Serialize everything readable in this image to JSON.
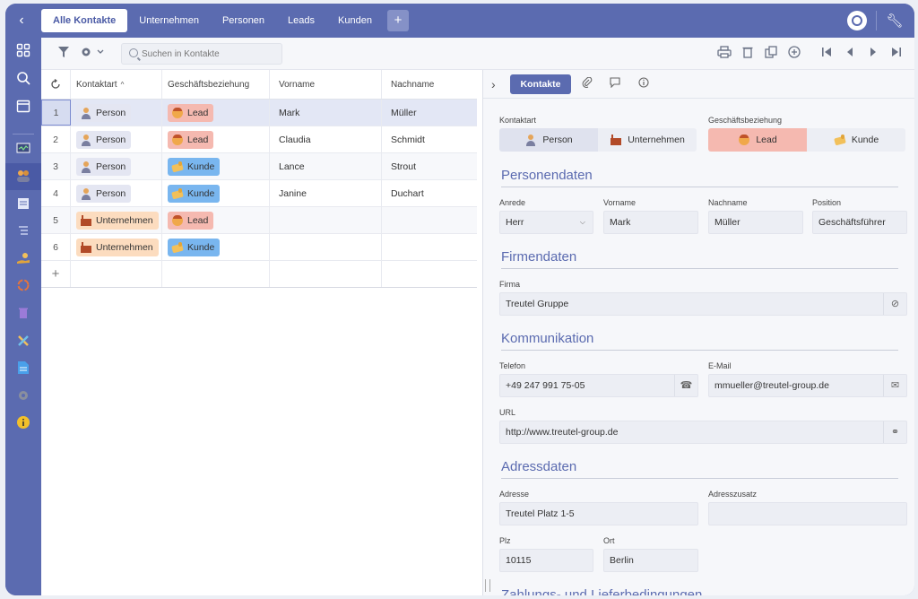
{
  "nav": {
    "back": "‹",
    "tabs": [
      {
        "label": "Alle Kontakte",
        "active": true
      },
      {
        "label": "Unternehmen"
      },
      {
        "label": "Personen"
      },
      {
        "label": "Leads"
      },
      {
        "label": "Kunden"
      }
    ],
    "add_tab": "+"
  },
  "toolbar": {
    "search_placeholder": "Suchen in Kontakte"
  },
  "grid": {
    "columns": [
      "Kontaktart",
      "Geschäftsbeziehung",
      "Vorname",
      "Nachname"
    ],
    "sort_indicator": "^",
    "rows": [
      {
        "num": "1",
        "kontaktart": "Person",
        "beziehung": "Lead",
        "vorname": "Mark",
        "nachname": "Müller"
      },
      {
        "num": "2",
        "kontaktart": "Person",
        "beziehung": "Lead",
        "vorname": "Claudia",
        "nachname": "Schmidt"
      },
      {
        "num": "3",
        "kontaktart": "Person",
        "beziehung": "Kunde",
        "vorname": "Lance",
        "nachname": "Strout"
      },
      {
        "num": "4",
        "kontaktart": "Person",
        "beziehung": "Kunde",
        "vorname": "Janine",
        "nachname": "Duchart"
      },
      {
        "num": "5",
        "kontaktart": "Unternehmen",
        "beziehung": "Lead",
        "vorname": "",
        "nachname": ""
      },
      {
        "num": "6",
        "kontaktart": "Unternehmen",
        "beziehung": "Kunde",
        "vorname": "",
        "nachname": ""
      }
    ],
    "add_row": "+"
  },
  "detail": {
    "tab": "Kontakte",
    "kontaktart_label": "Kontaktart",
    "kontaktart_options": [
      "Person",
      "Unternehmen"
    ],
    "beziehung_label": "Geschäftsbeziehung",
    "beziehung_options": [
      "Lead",
      "Kunde"
    ],
    "personendaten": {
      "title": "Personendaten",
      "anrede_label": "Anrede",
      "anrede": "Herr",
      "vorname_label": "Vorname",
      "vorname": "Mark",
      "nachname_label": "Nachname",
      "nachname": "Müller",
      "position_label": "Position",
      "position": "Geschäftsführer"
    },
    "firmendaten": {
      "title": "Firmendaten",
      "firma_label": "Firma",
      "firma": "Treutel Gruppe"
    },
    "kommunikation": {
      "title": "Kommunikation",
      "telefon_label": "Telefon",
      "telefon": "+49 247 991 75-05",
      "email_label": "E-Mail",
      "email": "mmueller@treutel-group.de",
      "url_label": "URL",
      "url": "http://www.treutel-group.de"
    },
    "adressdaten": {
      "title": "Adressdaten",
      "adresse_label": "Adresse",
      "adresse": "Treutel Platz 1-5",
      "adresszusatz_label": "Adresszusatz",
      "adresszusatz": "",
      "plz_label": "Plz",
      "plz": "10115",
      "ort_label": "Ort",
      "ort": "Berlin"
    },
    "zahlung": {
      "title": "Zahlungs- und Lieferbedingungen"
    }
  }
}
